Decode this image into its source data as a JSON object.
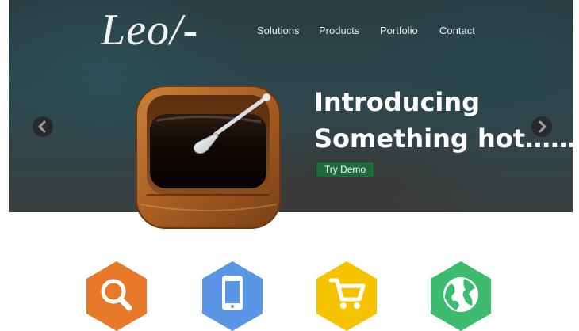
{
  "header": {
    "logo_text": "Leo/-",
    "nav": [
      {
        "label": "Solutions"
      },
      {
        "label": "Products"
      },
      {
        "label": "Portfolio"
      },
      {
        "label": "Contact"
      }
    ]
  },
  "slider": {
    "headline_line1": "Introducing",
    "headline_line2": "Something hot……",
    "button_label": "Try Demo",
    "prev_icon": "chevron-left",
    "next_icon": "chevron-right",
    "image_icon": "wooden-tray-spoon"
  },
  "features": [
    {
      "icon": "search",
      "color": "#e8792b"
    },
    {
      "icon": "tablet",
      "color": "#5b95e6"
    },
    {
      "icon": "cart",
      "color": "#f5c300"
    },
    {
      "icon": "globe",
      "color": "#3dbb6e"
    }
  ],
  "colors": {
    "button_bg": "#1f6a3a",
    "hero_bg": "#2d474c"
  }
}
